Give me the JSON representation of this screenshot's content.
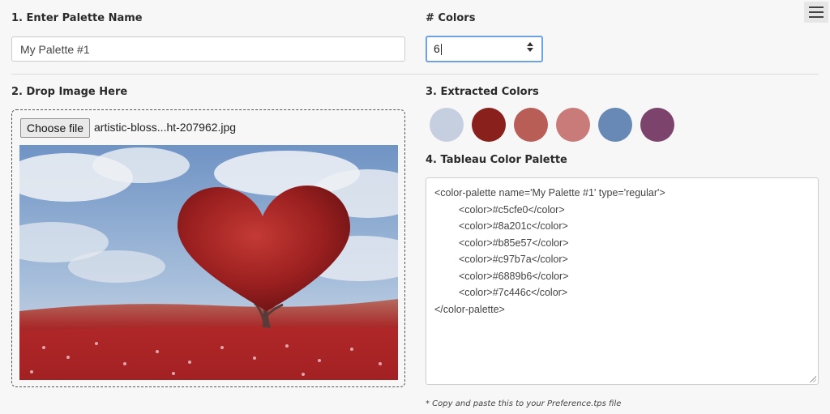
{
  "section1": {
    "label": "1. Enter Palette Name",
    "value": "My Palette #1"
  },
  "colors_count": {
    "label": "# Colors",
    "value": "6"
  },
  "section2": {
    "label": "2. Drop Image Here",
    "choose_file_label": "Choose file",
    "file_name": "artistic-bloss...ht-207962.jpg"
  },
  "section3": {
    "label": "3. Extracted Colors",
    "swatches": [
      "#c5cfe0",
      "#8a201c",
      "#b85e57",
      "#c97b7a",
      "#6889b6",
      "#7c446c"
    ]
  },
  "section4": {
    "label": "4. Tableau Color Palette",
    "code_lines": [
      "<color-palette name='My Palette #1' type='regular'>",
      "<color>#c5cfe0</color>",
      "<color>#8a201c</color>",
      "<color>#b85e57</color>",
      "<color>#c97b7a</color>",
      "<color>#6889b6</color>",
      "<color>#7c446c</color>",
      "</color-palette>"
    ],
    "note": "* Copy and paste this to your Preference.tps file"
  },
  "icons": {
    "menu": "hamburger-menu-icon",
    "spinner": "number-spinner-icon"
  }
}
